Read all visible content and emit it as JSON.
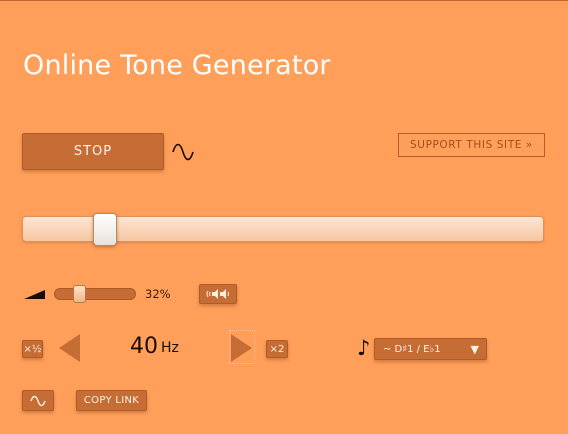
{
  "app": {
    "title": "Online Tone Generator"
  },
  "controls": {
    "play_label": "STOP",
    "support_label": "SUPPORT THIS SITE »",
    "copy_link_label": "COPY LINK"
  },
  "volume": {
    "percent_label": "32%",
    "value": 32
  },
  "frequency": {
    "value": "40",
    "unit": "Hz",
    "half_label": "×½",
    "double_label": "×2"
  },
  "note": {
    "selected": "~ D♯1 / E♭1",
    "caret": "▼"
  },
  "icons": {
    "waveform": "sine-wave-icon",
    "volume": "volume-wedge-icon",
    "balance": "speaker-balance-icon",
    "note": "music-note-icon",
    "note_glyph": "♪",
    "prev": "triangle-left-icon",
    "next": "triangle-right-icon"
  },
  "colors": {
    "background": "#ff9f5a",
    "button": "#c56d34",
    "button_text": "#fff1e4",
    "title": "#ffffff",
    "link_border": "#b25f29"
  }
}
